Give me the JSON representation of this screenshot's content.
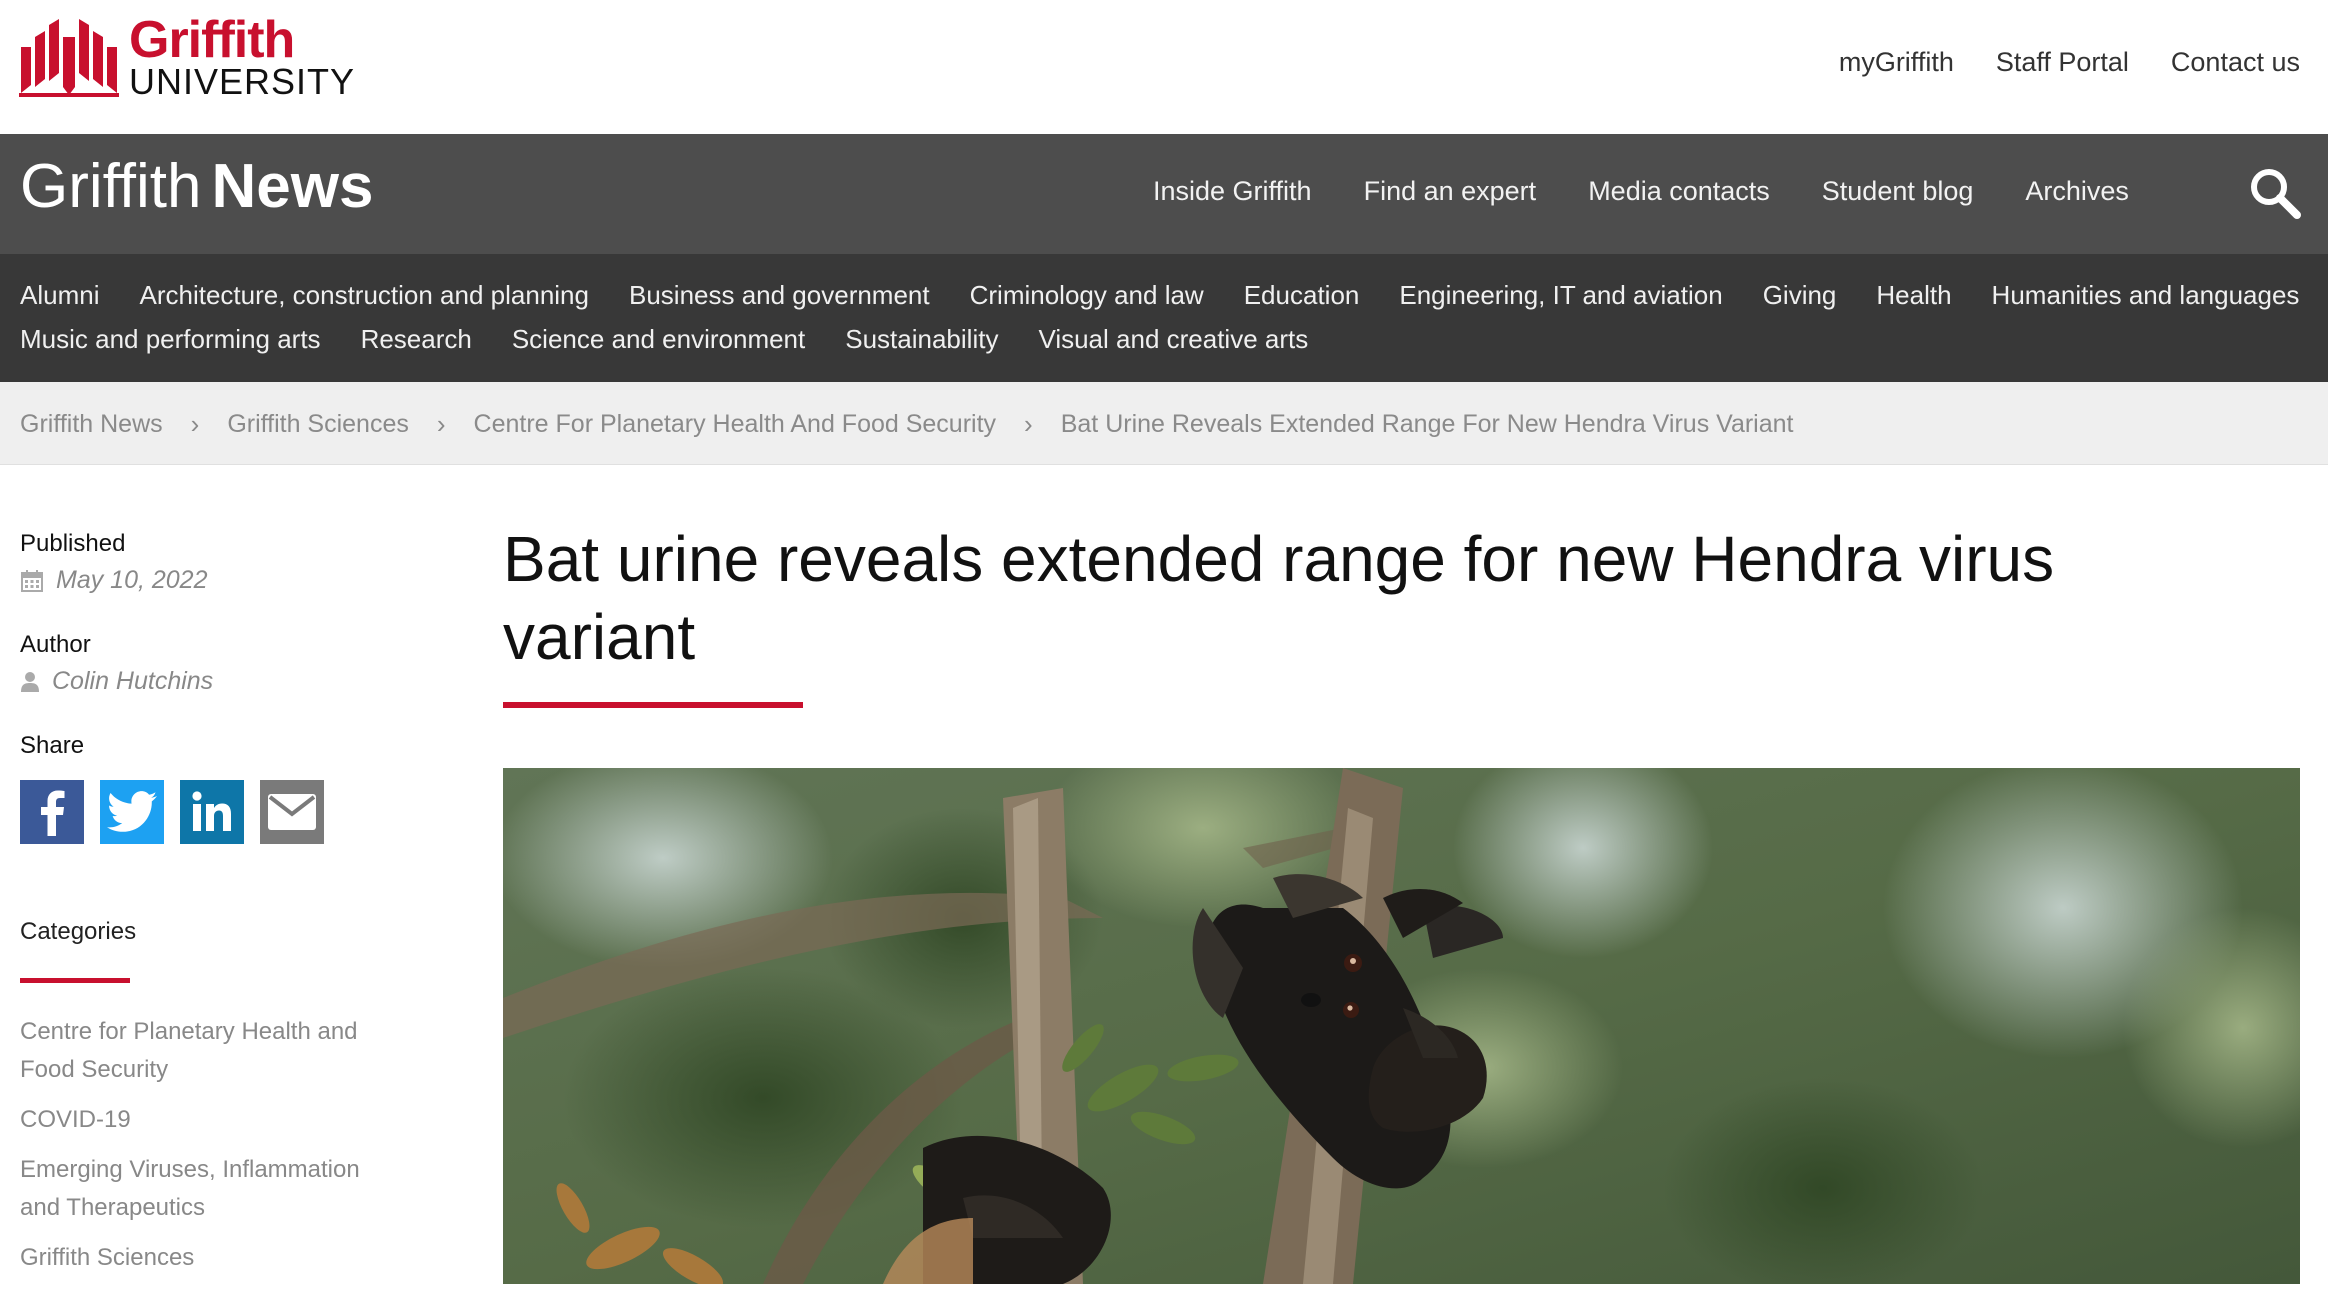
{
  "logo": {
    "name": "Griffith",
    "subtitle": "UNIVERSITY"
  },
  "util_nav": [
    "myGriffith",
    "Staff Portal",
    "Contact us"
  ],
  "site": {
    "title_light": "Griffith",
    "title_bold": "News"
  },
  "main_nav": [
    "Inside Griffith",
    "Find an expert",
    "Media contacts",
    "Student blog",
    "Archives"
  ],
  "icons": {
    "search": "search-icon",
    "calendar": "calendar-icon",
    "user": "user-icon"
  },
  "category_nav": {
    "row1": [
      "Alumni",
      "Architecture, construction and planning",
      "Business and government",
      "Criminology and law",
      "Education",
      "Engineering, IT and aviation",
      "Giving",
      "Health",
      "Humanities and languages"
    ],
    "row2": [
      "Music and performing arts",
      "Research",
      "Science and environment",
      "Sustainability",
      "Visual and creative arts"
    ]
  },
  "breadcrumb": [
    "Griffith News",
    "Griffith Sciences",
    "Centre For Planetary Health And Food Security",
    "Bat Urine Reveals Extended Range For New Hendra Virus Variant"
  ],
  "sidebar": {
    "published_label": "Published",
    "published_date": "May 10, 2022",
    "author_label": "Author",
    "author_name": "Colin Hutchins",
    "share_label": "Share",
    "share_buttons": [
      "facebook",
      "twitter",
      "linkedin",
      "email"
    ],
    "categories_label": "Categories",
    "categories": [
      "Centre for Planetary Health and Food Security",
      "COVID-19",
      "Emerging Viruses, Inflammation and Therapeutics",
      "Griffith Sciences"
    ]
  },
  "article": {
    "title": "Bat urine reveals extended range for new Hendra virus variant"
  },
  "colors": {
    "brand_red": "#c8102e",
    "news_bar": "#4d4d4d",
    "category_bar": "#383838",
    "breadcrumb_bg": "#efefef",
    "facebook": "#3b5998",
    "twitter": "#1da1f2",
    "linkedin": "#0e76a8",
    "email": "#7a7a7a"
  }
}
